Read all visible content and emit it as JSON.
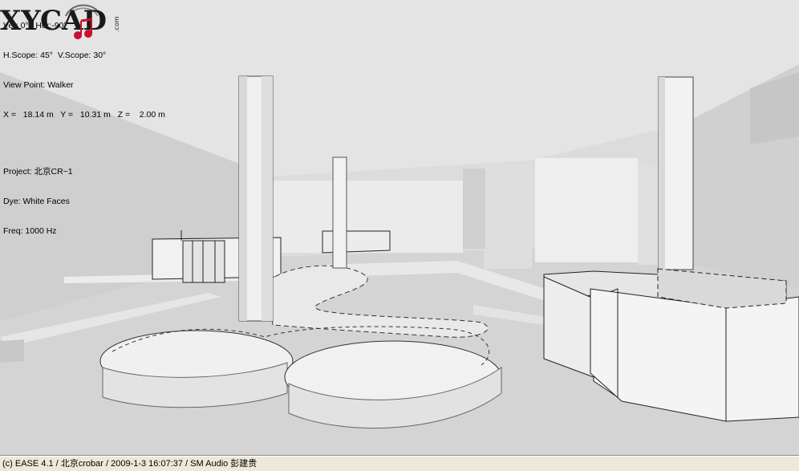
{
  "viewer": {
    "orientation": "Ver: 0°   Hor:-90°",
    "scope": "H.Scope: 45°  V.Scope: 30°",
    "viewpoint": "View Point: Walker",
    "coordinates": "X =   18.14 m   Y =   10.31 m   Z =    2.00 m",
    "project": "Project: 北京CR~1",
    "dye": "Dye: White Faces",
    "freq": "Freq: 1000 Hz"
  },
  "status": {
    "text": "(c) EASE 4.1  / 北京crobar  / 2009-1-3 16:07:37 / SM Audio 彭建贵"
  },
  "watermark": {
    "brand": "XYCAD",
    "suffix": ".com"
  },
  "colors": {
    "background": "#d6d6d6",
    "face_light": "#f2f2f2",
    "face_shadow": "#c4c4c4",
    "statusbar": "#ece9d8",
    "logo_red": "#c8102e"
  }
}
